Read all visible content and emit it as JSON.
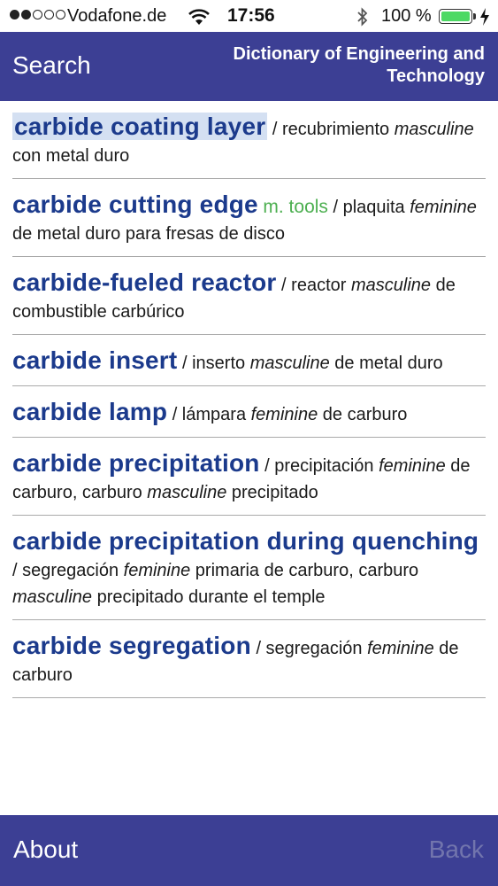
{
  "status": {
    "carrier": "Vodafone.de",
    "time": "17:56",
    "battery": "100 %",
    "signal_bars_filled": 2,
    "signal_bars_total": 5
  },
  "nav": {
    "search_label": "Search",
    "title": "Dictionary of Engineering and Technology"
  },
  "entries": [
    {
      "term": "carbide coating layer",
      "domain": "",
      "parts": [
        " / recubrimiento ",
        {
          "i": "masculine"
        },
        " con metal duro"
      ]
    },
    {
      "term": "carbide cutting edge",
      "domain": "m. tools",
      "parts": [
        " / plaquita ",
        {
          "i": "feminine"
        },
        " de metal duro para fresas de disco"
      ]
    },
    {
      "term": "carbide-fueled reactor",
      "domain": "",
      "parts": [
        " / reactor ",
        {
          "i": "masculine"
        },
        " de combustible carbúrico"
      ]
    },
    {
      "term": "carbide insert",
      "domain": "",
      "parts": [
        " / inserto ",
        {
          "i": "masculine"
        },
        " de metal duro"
      ]
    },
    {
      "term": "carbide lamp",
      "domain": "",
      "parts": [
        " / lámpara ",
        {
          "i": "feminine"
        },
        " de carburo"
      ]
    },
    {
      "term": "carbide precipitation",
      "domain": "",
      "parts": [
        " / precipitación ",
        {
          "i": "feminine"
        },
        " de carburo, carburo ",
        {
          "i": "masculine"
        },
        " precipitado"
      ]
    },
    {
      "term": "carbide precipitation during quenching",
      "domain": "",
      "parts": [
        " / segregación ",
        {
          "i": "feminine"
        },
        " primaria de carburo, carburo ",
        {
          "i": "masculine"
        },
        " precipitado durante el temple"
      ]
    },
    {
      "term": "carbide segregation",
      "domain": "",
      "parts": [
        " / segregación ",
        {
          "i": "feminine"
        },
        " de carburo"
      ]
    }
  ],
  "toolbar": {
    "about_label": "About",
    "back_label": "Back"
  },
  "colors": {
    "bar_bg": "#3c3f94",
    "term": "#1b3a8c",
    "domain": "#4caf50",
    "selected_bg": "#d4e0f2",
    "back_disabled": "#7275ad"
  }
}
